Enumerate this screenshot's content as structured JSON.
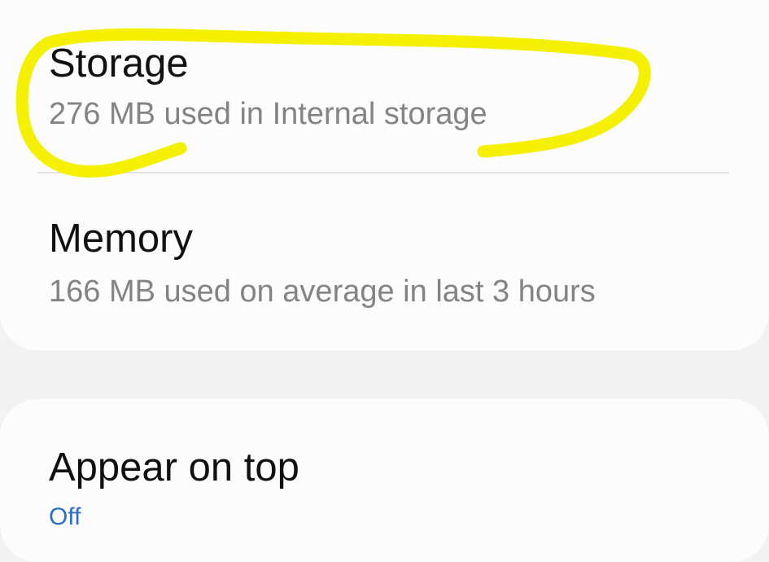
{
  "storage": {
    "title": "Storage",
    "subtitle": "276 MB used in Internal storage"
  },
  "memory": {
    "title": "Memory",
    "subtitle": "166 MB used on average in last 3 hours"
  },
  "appear_on_top": {
    "title": "Appear on top",
    "status": "Off"
  },
  "colors": {
    "background": "#f2f2f2",
    "card": "#fcfcfc",
    "title_text": "#111111",
    "subtitle_text": "#838383",
    "status_accent": "#2d6fc4",
    "highlight_annotation": "#f4f000"
  }
}
